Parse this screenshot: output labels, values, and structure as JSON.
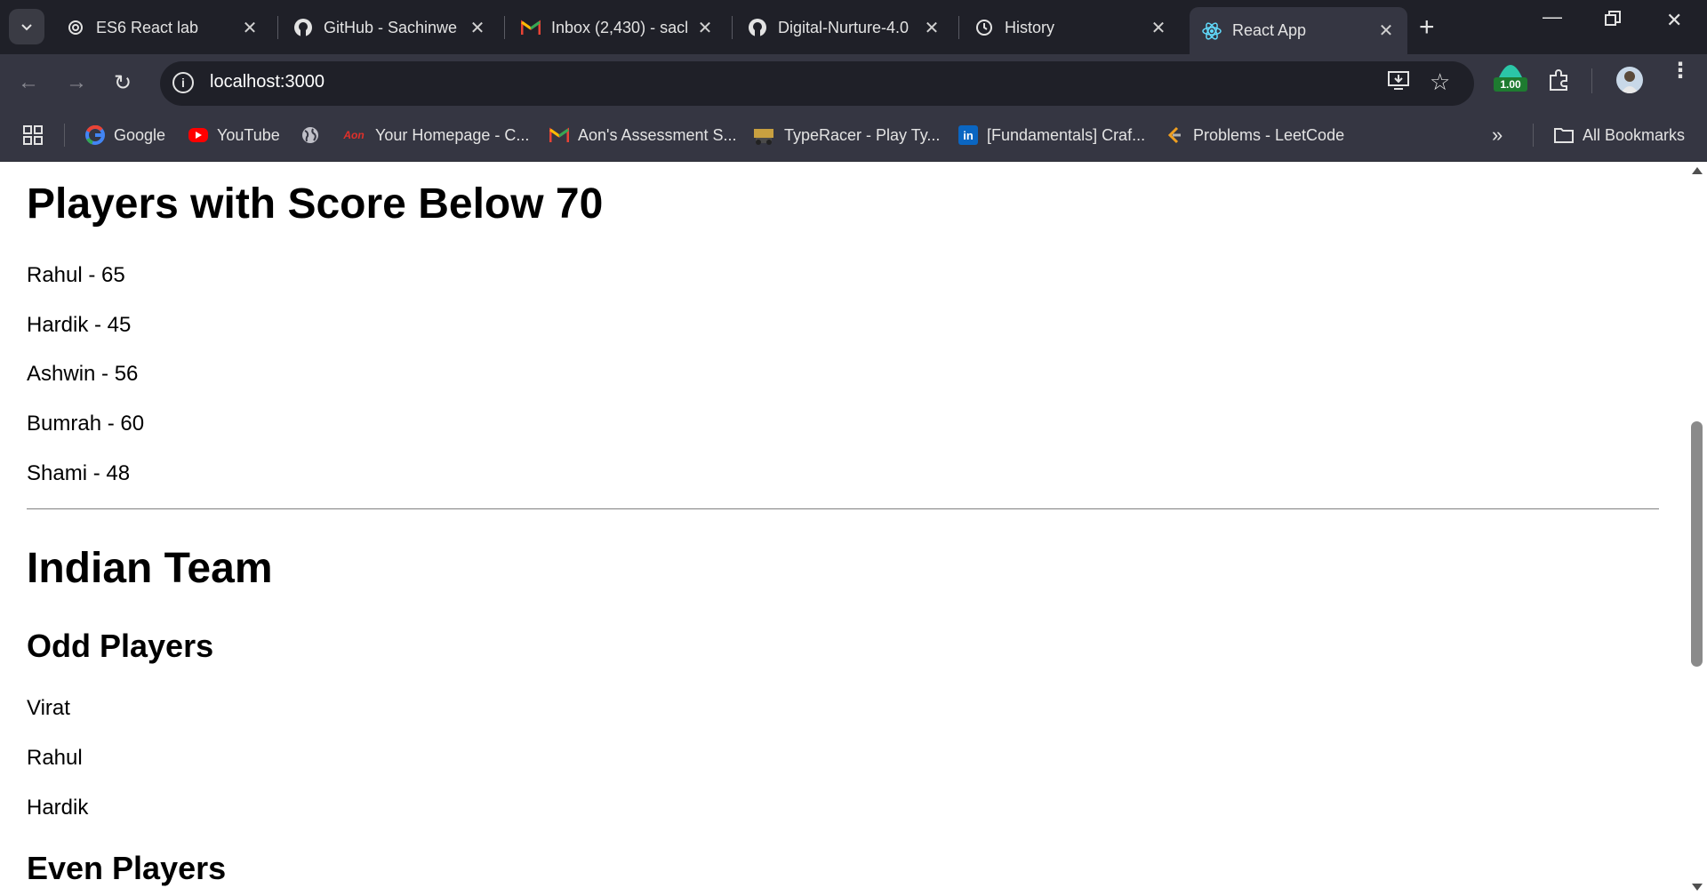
{
  "tabs": [
    {
      "title": "ES6 React lab",
      "icon": "openai-icon"
    },
    {
      "title": "GitHub - Sachinwe",
      "icon": "github-icon"
    },
    {
      "title": "Inbox (2,430) - sacl",
      "icon": "gmail-icon"
    },
    {
      "title": "Digital-Nurture-4.0",
      "icon": "github-icon"
    },
    {
      "title": "History",
      "icon": "history-icon"
    },
    {
      "title": "React App",
      "icon": "react-icon",
      "active": true
    }
  ],
  "address_bar": {
    "url": "localhost:3000"
  },
  "extension_badge": "1.00",
  "bookmarks": [
    {
      "label": "Google",
      "icon": "google-icon"
    },
    {
      "label": "YouTube",
      "icon": "youtube-icon"
    },
    {
      "label": "",
      "icon": "globe-icon"
    },
    {
      "label": "Your Homepage - C...",
      "icon": "aon-icon",
      "icon_text": "Aon"
    },
    {
      "label": "Aon's Assessment S...",
      "icon": "gmail-icon"
    },
    {
      "label": "TypeRacer - Play Ty...",
      "icon": "typeracer-icon"
    },
    {
      "label": "[Fundamentals] Craf...",
      "icon": "linkedin-icon",
      "icon_text": "in"
    },
    {
      "label": "Problems - LeetCode",
      "icon": "leetcode-icon"
    }
  ],
  "all_bookmarks_label": "All Bookmarks",
  "page": {
    "score_heading": "Players with Score Below 70",
    "low_scorers": [
      "Rahul - 65",
      "Hardik - 45",
      "Ashwin - 56",
      "Bumrah - 60",
      "Shami - 48"
    ],
    "team_heading": "Indian Team",
    "odd_heading": "Odd Players",
    "odd_players": [
      "Virat",
      "Rahul",
      "Hardik"
    ],
    "even_heading": "Even Players"
  },
  "colors": {
    "tabstrip_bg": "#1f2028",
    "toolbar_bg": "#353642",
    "page_bg": "#ffffff",
    "text": "#000000"
  }
}
